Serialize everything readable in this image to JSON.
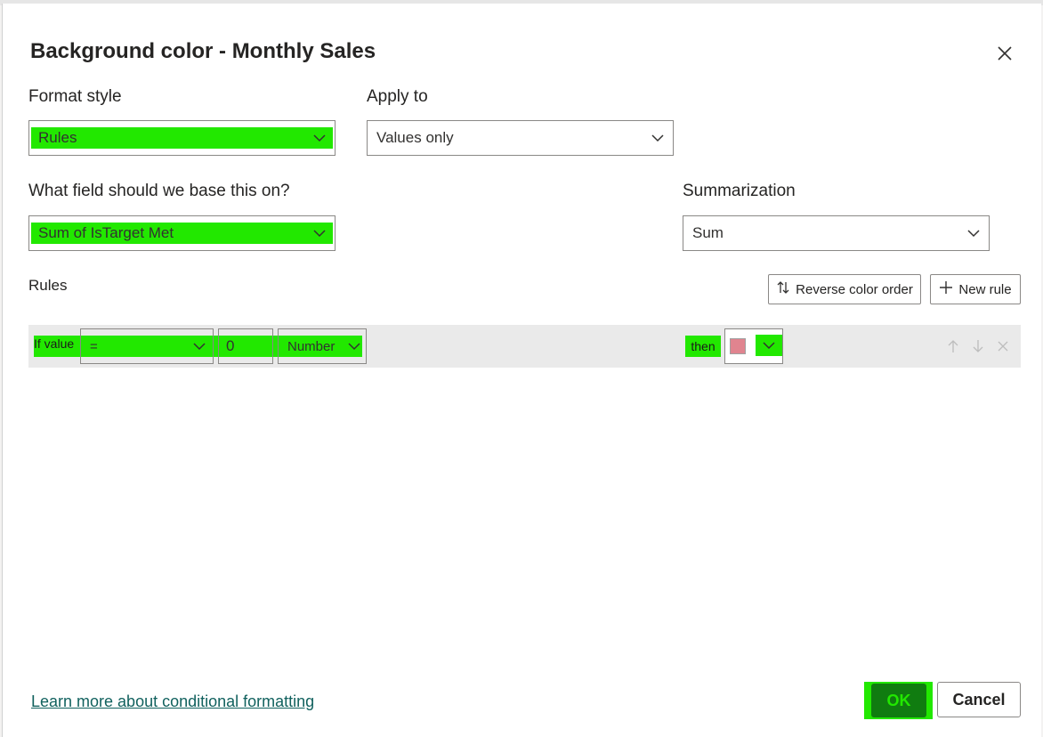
{
  "dialog": {
    "title": "Background color - Monthly Sales",
    "close_icon": "close-icon"
  },
  "format_style": {
    "label": "Format style",
    "value": "Rules"
  },
  "apply_to": {
    "label": "Apply to",
    "value": "Values only"
  },
  "base_field": {
    "label": "What field should we base this on?",
    "value": "Sum of IsTarget Met"
  },
  "summarization": {
    "label": "Summarization",
    "value": "Sum"
  },
  "rules": {
    "label": "Rules",
    "reverse_button": "Reverse color order",
    "new_rule_button": "New rule",
    "row": {
      "if_label": "If value",
      "operator": "=",
      "value": "0",
      "type": "Number",
      "then_label": "then",
      "color": "#e0848f"
    }
  },
  "footer": {
    "link": "Learn more about conditional formatting",
    "ok": "OK",
    "cancel": "Cancel"
  },
  "colors": {
    "highlight": "#22e800",
    "ok_background": "#107c10",
    "link": "#11615e"
  }
}
